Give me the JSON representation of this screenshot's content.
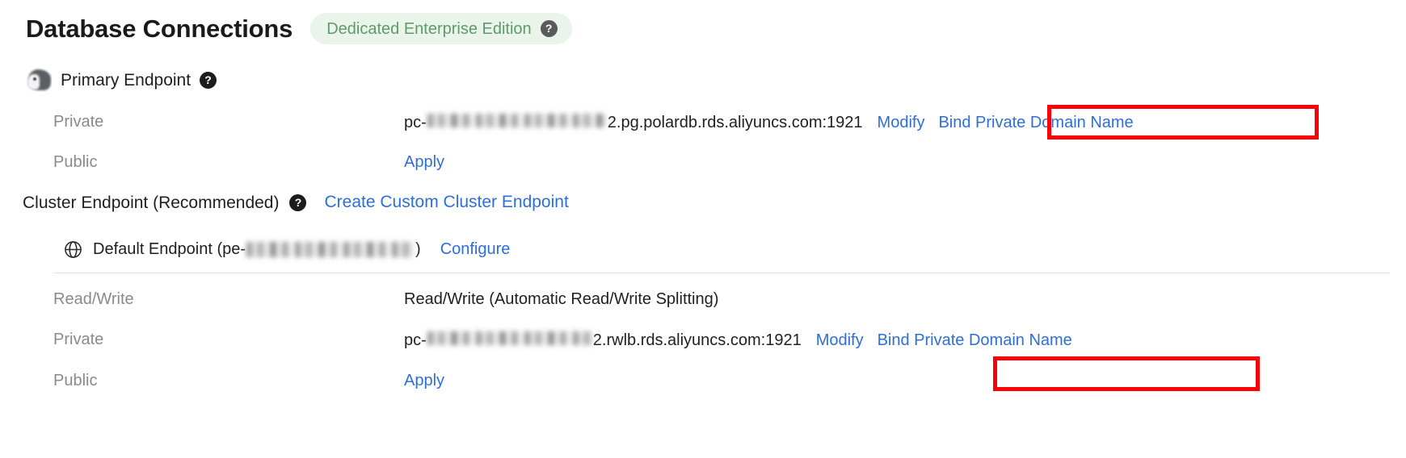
{
  "header": {
    "title": "Database Connections",
    "edition_badge": {
      "label": "Dedicated Enterprise Edition",
      "help_icon": "?"
    }
  },
  "colors": {
    "link": "#2d6fd8",
    "badge_text": "#5d9b6a",
    "badge_background": "#eaf4ea",
    "highlight_box": "#fb0007",
    "label_text": "#8a8a8a",
    "body_text": "#1f1f1f"
  },
  "primary_endpoint": {
    "title": "Primary Endpoint",
    "icon": "polardb-mascot-icon",
    "help_icon": "?",
    "rows": [
      {
        "label": "Private",
        "value_prefix": "pc-",
        "value_redacted": true,
        "value_suffix": "2.pg.polardb.rds.aliyuncs.com:1921",
        "actions": [
          "Modify",
          "Bind Private Domain Name"
        ],
        "highlighted_action": "Bind Private Domain Name"
      },
      {
        "label": "Public",
        "value_prefix": "",
        "value_redacted": false,
        "value_suffix": "",
        "actions": [
          "Apply"
        ],
        "highlighted_action": ""
      }
    ]
  },
  "cluster_endpoint": {
    "title": "Cluster Endpoint (Recommended)",
    "help_icon": "?",
    "create_link": "Create Custom Cluster Endpoint",
    "default_endpoint": {
      "icon": "globe-icon",
      "label_prefix": "Default Endpoint (pe-",
      "id_redacted": true,
      "label_suffix": ")",
      "configure_link": "Configure"
    },
    "rows": [
      {
        "label": "Read/Write",
        "value_prefix": "Read/Write (Automatic Read/Write Splitting)",
        "value_redacted": false,
        "value_suffix": "",
        "actions": [],
        "highlighted_action": ""
      },
      {
        "label": "Private",
        "value_prefix": "pc-",
        "value_redacted": true,
        "value_suffix": "2.rwlb.rds.aliyuncs.com:1921",
        "actions": [
          "Modify",
          "Bind Private Domain Name"
        ],
        "highlighted_action": "Bind Private Domain Name"
      },
      {
        "label": "Public",
        "value_prefix": "",
        "value_redacted": false,
        "value_suffix": "",
        "actions": [
          "Apply"
        ],
        "highlighted_action": ""
      }
    ]
  }
}
